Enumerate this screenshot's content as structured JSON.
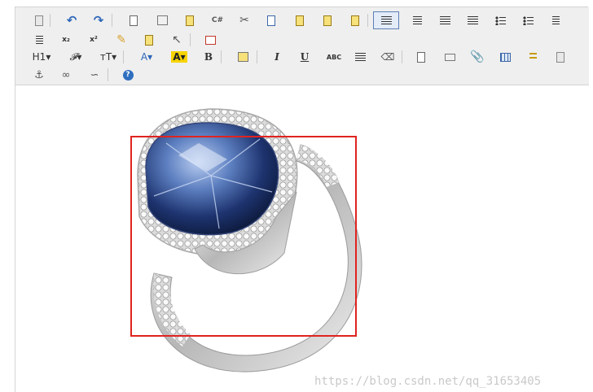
{
  "toolbar": {
    "row1": [
      {
        "name": "source-icon",
        "glyph": ""
      },
      {
        "name": "undo-icon",
        "glyph": "↶"
      },
      {
        "name": "redo-icon",
        "glyph": "↷"
      },
      {
        "name": "preview-icon",
        "glyph": ""
      },
      {
        "name": "print-icon",
        "glyph": ""
      },
      {
        "name": "template-icon",
        "glyph": ""
      },
      {
        "name": "code-icon",
        "glyph": "C#"
      },
      {
        "name": "cut-icon",
        "glyph": "✂"
      },
      {
        "name": "copy-icon",
        "glyph": ""
      },
      {
        "name": "paste-icon",
        "glyph": ""
      },
      {
        "name": "paste-text-icon",
        "glyph": ""
      },
      {
        "name": "paste-word-icon",
        "glyph": ""
      },
      {
        "name": "align-left-icon",
        "glyph": ""
      },
      {
        "name": "align-center-icon",
        "glyph": ""
      },
      {
        "name": "align-right-icon",
        "glyph": ""
      },
      {
        "name": "align-justify-icon",
        "glyph": ""
      },
      {
        "name": "numbered-list-icon",
        "glyph": ""
      },
      {
        "name": "bullet-list-icon",
        "glyph": ""
      },
      {
        "name": "indent-icon",
        "glyph": ""
      }
    ],
    "row2": [
      {
        "name": "outdent-icon",
        "glyph": ""
      },
      {
        "name": "subscript-icon",
        "glyph": "x₂"
      },
      {
        "name": "superscript-icon",
        "glyph": "x²"
      },
      {
        "name": "clear-format-icon",
        "glyph": ""
      },
      {
        "name": "select-all-icon",
        "glyph": ""
      },
      {
        "name": "pointer-icon",
        "glyph": "↖"
      },
      {
        "name": "fullscreen-icon",
        "glyph": ""
      }
    ],
    "row3": [
      {
        "name": "heading-dropdown",
        "glyph": "H1▾"
      },
      {
        "name": "font-family-dropdown",
        "glyph": "𝓕▾"
      },
      {
        "name": "font-size-dropdown",
        "glyph": "тT▾"
      },
      {
        "name": "text-color-dropdown",
        "glyph": "A▾"
      },
      {
        "name": "highlight-color-dropdown",
        "glyph": "A▾"
      },
      {
        "name": "bold-icon",
        "glyph": "B"
      },
      {
        "name": "insert-image-icon",
        "glyph": ""
      },
      {
        "name": "italic-icon",
        "glyph": "I"
      },
      {
        "name": "underline-icon",
        "glyph": "U"
      },
      {
        "name": "strikethrough-icon",
        "glyph": "ABC"
      },
      {
        "name": "horizontal-rule-icon",
        "glyph": ""
      },
      {
        "name": "eraser-icon",
        "glyph": ""
      },
      {
        "name": "insert-link-icon",
        "glyph": ""
      },
      {
        "name": "video-icon",
        "glyph": ""
      },
      {
        "name": "attachment-icon",
        "glyph": ""
      },
      {
        "name": "table-icon",
        "glyph": ""
      },
      {
        "name": "insert-row-icon",
        "glyph": ""
      },
      {
        "name": "page-break-icon",
        "glyph": ""
      }
    ],
    "row4": [
      {
        "name": "anchor-icon",
        "glyph": "⚓"
      },
      {
        "name": "link-icon",
        "glyph": ""
      },
      {
        "name": "unlink-icon",
        "glyph": ""
      },
      {
        "name": "help-icon",
        "glyph": "?"
      }
    ]
  },
  "editor": {
    "image_alt": "Sapphire halo ring",
    "watermark": "https://blog.csdn.net/qq_31653405"
  },
  "colors": {
    "toolbar_bg": "#efefef",
    "selection_border": "#e0231f",
    "active_button_border": "#5b7fb4",
    "highlight_yellow": "#f7d400"
  }
}
